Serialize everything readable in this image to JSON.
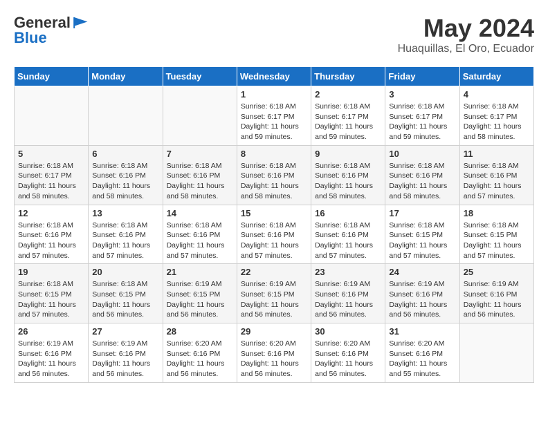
{
  "logo": {
    "general": "General",
    "blue": "Blue"
  },
  "title": {
    "month_year": "May 2024",
    "location": "Huaquillas, El Oro, Ecuador"
  },
  "days_of_week": [
    "Sunday",
    "Monday",
    "Tuesday",
    "Wednesday",
    "Thursday",
    "Friday",
    "Saturday"
  ],
  "weeks": [
    [
      {
        "day": "",
        "info": ""
      },
      {
        "day": "",
        "info": ""
      },
      {
        "day": "",
        "info": ""
      },
      {
        "day": "1",
        "info": "Sunrise: 6:18 AM\nSunset: 6:17 PM\nDaylight: 11 hours and 59 minutes."
      },
      {
        "day": "2",
        "info": "Sunrise: 6:18 AM\nSunset: 6:17 PM\nDaylight: 11 hours and 59 minutes."
      },
      {
        "day": "3",
        "info": "Sunrise: 6:18 AM\nSunset: 6:17 PM\nDaylight: 11 hours and 59 minutes."
      },
      {
        "day": "4",
        "info": "Sunrise: 6:18 AM\nSunset: 6:17 PM\nDaylight: 11 hours and 58 minutes."
      }
    ],
    [
      {
        "day": "5",
        "info": "Sunrise: 6:18 AM\nSunset: 6:17 PM\nDaylight: 11 hours and 58 minutes."
      },
      {
        "day": "6",
        "info": "Sunrise: 6:18 AM\nSunset: 6:16 PM\nDaylight: 11 hours and 58 minutes."
      },
      {
        "day": "7",
        "info": "Sunrise: 6:18 AM\nSunset: 6:16 PM\nDaylight: 11 hours and 58 minutes."
      },
      {
        "day": "8",
        "info": "Sunrise: 6:18 AM\nSunset: 6:16 PM\nDaylight: 11 hours and 58 minutes."
      },
      {
        "day": "9",
        "info": "Sunrise: 6:18 AM\nSunset: 6:16 PM\nDaylight: 11 hours and 58 minutes."
      },
      {
        "day": "10",
        "info": "Sunrise: 6:18 AM\nSunset: 6:16 PM\nDaylight: 11 hours and 58 minutes."
      },
      {
        "day": "11",
        "info": "Sunrise: 6:18 AM\nSunset: 6:16 PM\nDaylight: 11 hours and 57 minutes."
      }
    ],
    [
      {
        "day": "12",
        "info": "Sunrise: 6:18 AM\nSunset: 6:16 PM\nDaylight: 11 hours and 57 minutes."
      },
      {
        "day": "13",
        "info": "Sunrise: 6:18 AM\nSunset: 6:16 PM\nDaylight: 11 hours and 57 minutes."
      },
      {
        "day": "14",
        "info": "Sunrise: 6:18 AM\nSunset: 6:16 PM\nDaylight: 11 hours and 57 minutes."
      },
      {
        "day": "15",
        "info": "Sunrise: 6:18 AM\nSunset: 6:16 PM\nDaylight: 11 hours and 57 minutes."
      },
      {
        "day": "16",
        "info": "Sunrise: 6:18 AM\nSunset: 6:16 PM\nDaylight: 11 hours and 57 minutes."
      },
      {
        "day": "17",
        "info": "Sunrise: 6:18 AM\nSunset: 6:15 PM\nDaylight: 11 hours and 57 minutes."
      },
      {
        "day": "18",
        "info": "Sunrise: 6:18 AM\nSunset: 6:15 PM\nDaylight: 11 hours and 57 minutes."
      }
    ],
    [
      {
        "day": "19",
        "info": "Sunrise: 6:18 AM\nSunset: 6:15 PM\nDaylight: 11 hours and 57 minutes."
      },
      {
        "day": "20",
        "info": "Sunrise: 6:18 AM\nSunset: 6:15 PM\nDaylight: 11 hours and 56 minutes."
      },
      {
        "day": "21",
        "info": "Sunrise: 6:19 AM\nSunset: 6:15 PM\nDaylight: 11 hours and 56 minutes."
      },
      {
        "day": "22",
        "info": "Sunrise: 6:19 AM\nSunset: 6:15 PM\nDaylight: 11 hours and 56 minutes."
      },
      {
        "day": "23",
        "info": "Sunrise: 6:19 AM\nSunset: 6:16 PM\nDaylight: 11 hours and 56 minutes."
      },
      {
        "day": "24",
        "info": "Sunrise: 6:19 AM\nSunset: 6:16 PM\nDaylight: 11 hours and 56 minutes."
      },
      {
        "day": "25",
        "info": "Sunrise: 6:19 AM\nSunset: 6:16 PM\nDaylight: 11 hours and 56 minutes."
      }
    ],
    [
      {
        "day": "26",
        "info": "Sunrise: 6:19 AM\nSunset: 6:16 PM\nDaylight: 11 hours and 56 minutes."
      },
      {
        "day": "27",
        "info": "Sunrise: 6:19 AM\nSunset: 6:16 PM\nDaylight: 11 hours and 56 minutes."
      },
      {
        "day": "28",
        "info": "Sunrise: 6:20 AM\nSunset: 6:16 PM\nDaylight: 11 hours and 56 minutes."
      },
      {
        "day": "29",
        "info": "Sunrise: 6:20 AM\nSunset: 6:16 PM\nDaylight: 11 hours and 56 minutes."
      },
      {
        "day": "30",
        "info": "Sunrise: 6:20 AM\nSunset: 6:16 PM\nDaylight: 11 hours and 56 minutes."
      },
      {
        "day": "31",
        "info": "Sunrise: 6:20 AM\nSunset: 6:16 PM\nDaylight: 11 hours and 55 minutes."
      },
      {
        "day": "",
        "info": ""
      }
    ]
  ]
}
